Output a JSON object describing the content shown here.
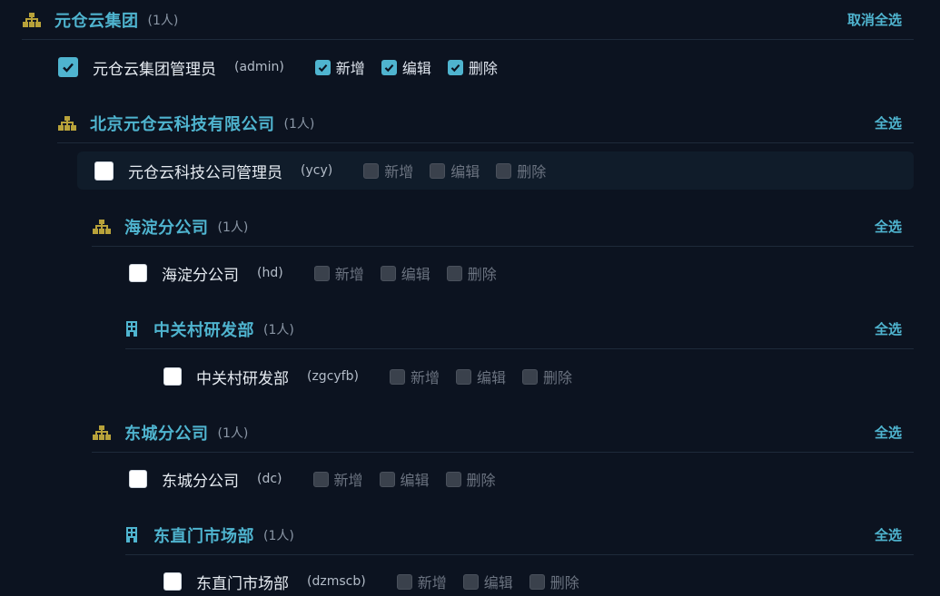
{
  "count_suffix": "(1人)",
  "perm_labels": {
    "add": "新增",
    "edit": "编辑",
    "delete": "删除"
  },
  "groups": [
    {
      "title": "元仓云集团",
      "count": "(1人)",
      "action": "取消全选",
      "icon": "org-tree-icon"
    },
    {
      "title": "北京元仓云科技有限公司",
      "count": "(1人)",
      "action": "全选",
      "icon": "org-tree-icon"
    },
    {
      "title": "海淀分公司",
      "count": "(1人)",
      "action": "全选",
      "icon": "org-tree-icon"
    },
    {
      "title": "中关村研发部",
      "count": "(1人)",
      "action": "全选",
      "icon": "building-icon"
    },
    {
      "title": "东城分公司",
      "count": "(1人)",
      "action": "全选",
      "icon": "org-tree-icon"
    },
    {
      "title": "东直门市场部",
      "count": "(1人)",
      "action": "全选",
      "icon": "building-icon"
    }
  ],
  "users": [
    {
      "name": "元仓云集团管理员",
      "code": "(admin)",
      "checked": true
    },
    {
      "name": "元仓云科技公司管理员",
      "code": "(ycy)",
      "checked": false
    },
    {
      "name": "海淀分公司",
      "code": "(hd)",
      "checked": false
    },
    {
      "name": "中关村研发部",
      "code": "(zgcyfb)",
      "checked": false
    },
    {
      "name": "东城分公司",
      "code": "(dc)",
      "checked": false
    },
    {
      "name": "东直门市场部",
      "code": "(dzmscb)",
      "checked": false
    }
  ],
  "colors": {
    "accent": "#4fb4cf",
    "icon_gold": "#b8a23a",
    "background": "#0c1320"
  }
}
